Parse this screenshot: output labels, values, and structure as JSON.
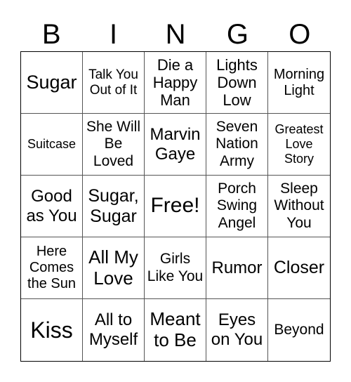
{
  "header": [
    "B",
    "I",
    "N",
    "G",
    "O"
  ],
  "cells": [
    "Sugar",
    "Talk You Out of It",
    "Die a Happy Man",
    "Lights Down Low",
    "Morning Light",
    "Suitcase",
    "She Will Be Loved",
    "Marvin Gaye",
    "Seven Nation Army",
    "Greatest Love Story",
    "Good as You",
    "Sugar, Sugar",
    "Free!",
    "Porch Swing Angel",
    "Sleep Without You",
    "Here Comes the Sun",
    "All My Love",
    "Girls Like You",
    "Rumor",
    "Closer",
    "Kiss",
    "All to Myself",
    "Meant to Be",
    "Eyes on You",
    "Beyond"
  ]
}
